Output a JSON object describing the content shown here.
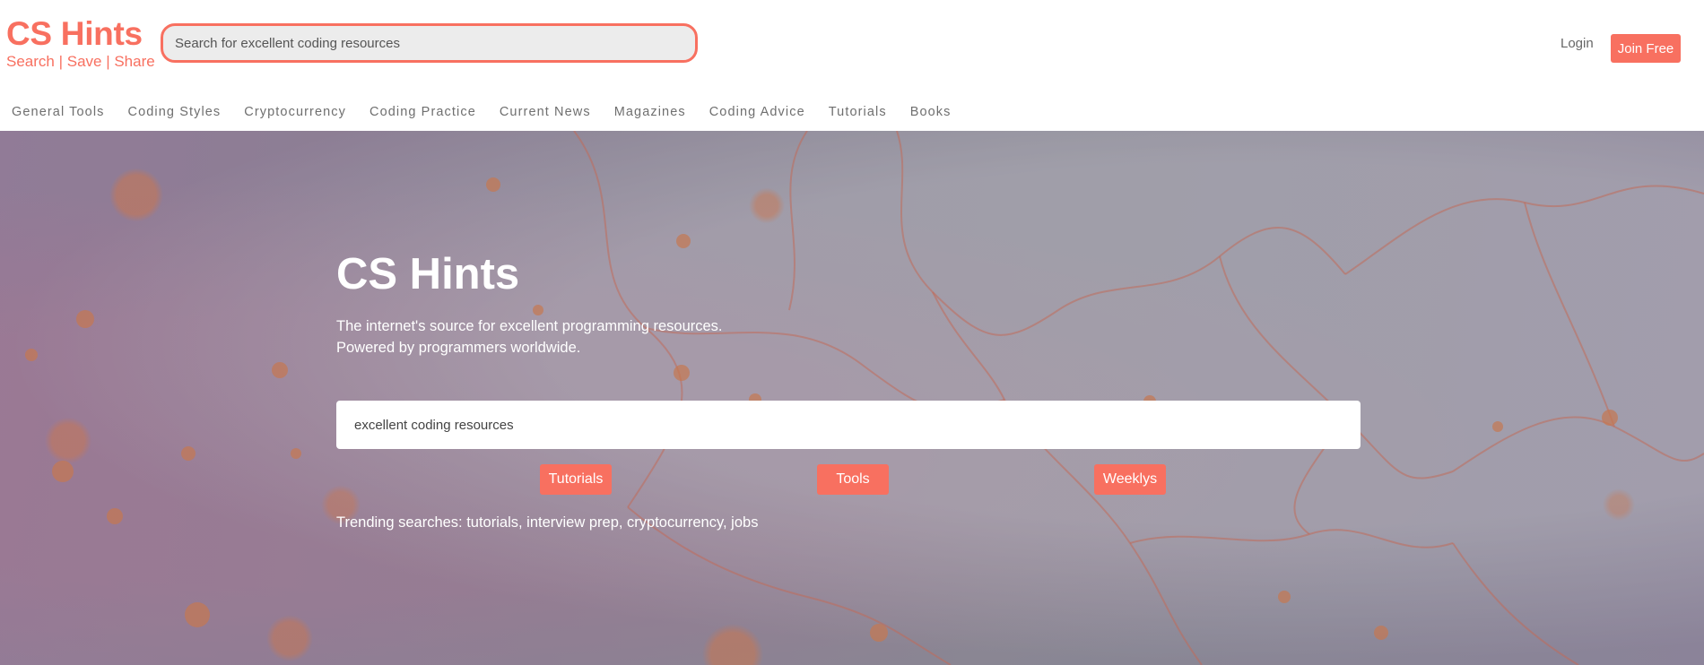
{
  "brand": {
    "title": "CS Hints",
    "tagline": "Search | Save | Share"
  },
  "top_search": {
    "placeholder": "Search for excellent coding resources"
  },
  "auth": {
    "login_label": "Login",
    "join_label": "Join Free"
  },
  "nav": {
    "items": [
      {
        "label": "General Tools"
      },
      {
        "label": "Coding Styles"
      },
      {
        "label": "Cryptocurrency"
      },
      {
        "label": "Coding Practice"
      },
      {
        "label": "Current News"
      },
      {
        "label": "Magazines"
      },
      {
        "label": "Coding Advice"
      },
      {
        "label": "Tutorials"
      },
      {
        "label": "Books"
      }
    ]
  },
  "hero": {
    "title": "CS Hints",
    "subtitle_line1": "The internet's source for excellent programming resources.",
    "subtitle_line2": "Powered by programmers worldwide.",
    "search_placeholder": "excellent coding resources",
    "quick_buttons": [
      {
        "label": "Tutorials"
      },
      {
        "label": "Tools"
      },
      {
        "label": "Weeklys"
      }
    ],
    "trending": "Trending searches: tutorials, interview prep, cryptocurrency, jobs"
  },
  "colors": {
    "accent": "#f87060",
    "nav_text": "#6f6f6f"
  }
}
